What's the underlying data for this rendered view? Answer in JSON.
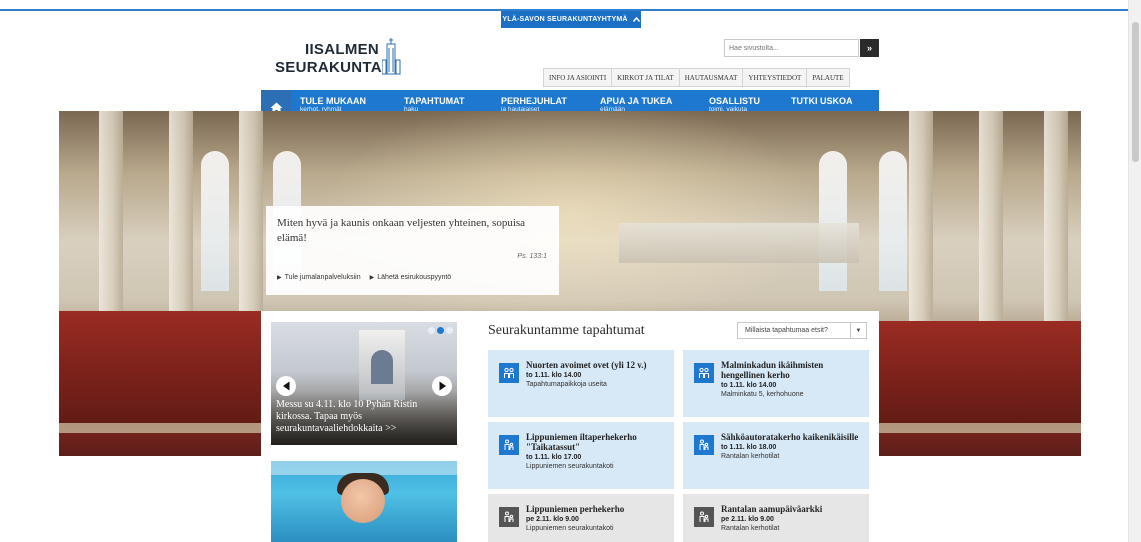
{
  "top_tab": {
    "label": "YLÄ-SAVON SEURAKUNTAYHTYMÄ",
    "icon": "chevron-up-icon"
  },
  "logo": {
    "line1": "IISALMEN",
    "line2": "SEURAKUNTA"
  },
  "search": {
    "placeholder": "Hae sivustolta...",
    "button_label": "»"
  },
  "util_nav": [
    "INFO JA ASIOINTI",
    "KIRKOT JA TILAT",
    "HAUTAUSMAAT",
    "YHTEYSTIEDOT",
    "PALAUTE"
  ],
  "main_nav": {
    "home_icon": "home-icon",
    "items": [
      {
        "title": "TULE MUKAAN",
        "sub": "kerhot, ryhmät"
      },
      {
        "title": "TAPAHTUMAT",
        "sub": "haku"
      },
      {
        "title": "PERHEJUHLAT",
        "sub": "ja hautajaiset"
      },
      {
        "title": "APUA JA TUKEA",
        "sub": "elämään"
      },
      {
        "title": "OSALLISTU",
        "sub": "toimi, vaikuta"
      },
      {
        "title": "TUTKI USKOA",
        "sub": ""
      }
    ]
  },
  "hero_quote": {
    "text": "Miten hyvä ja kaunis onkaan veljesten yhteinen, sopuisa elämä!",
    "reference": "Ps. 133:1",
    "links": [
      "Tule jumalanpalveluksiin",
      "Lähetä esirukouspyyntö"
    ]
  },
  "slider": {
    "caption": "Messu su 4.11. klo 10 Pyhän Ristin kirkossa. Tapaa myös seurakuntavaaliehdokkaita >>",
    "slides": 3,
    "active_slide": 2
  },
  "events": {
    "title": "Seurakuntamme tapahtumat",
    "filter_placeholder": "Millaista tapahtumaa etsit?",
    "items": [
      {
        "name": "Nuorten avoimet ovet (yli 12 v.)",
        "time": "to 1.11. klo 14.00",
        "place": "Tapahtumapaikkoja useita",
        "color": "blue"
      },
      {
        "name": "Malminkadun ikäihmisten hengellinen kerho",
        "time": "to 1.11. klo 14.00",
        "place": "Malminkatu 5, kerhohuone",
        "color": "blue"
      },
      {
        "name": "Lippuniemen iltaperhekerho \"Taikatassut\"",
        "time": "to 1.11. klo 17.00",
        "place": "Lippuniemen seurakuntakoti",
        "color": "blue"
      },
      {
        "name": "Sähköautoratakerho kaikenikäisille",
        "time": "to 1.11. klo 18.00",
        "place": "Rantalan kerhotilat",
        "color": "blue"
      },
      {
        "name": "Lippuniemen perhekerho",
        "time": "pe 2.11. klo 9.00",
        "place": "Lippuniemen seurakuntakoti",
        "color": "grey"
      },
      {
        "name": "Rantalan aamupäiväarkki",
        "time": "pe 2.11. klo 9.00",
        "place": "Rantalan kerhotilat",
        "color": "grey"
      }
    ]
  },
  "colors": {
    "brand_blue": "#1e78cf",
    "event_blue": "#d7e8f6",
    "event_grey": "#e6e6e6"
  }
}
